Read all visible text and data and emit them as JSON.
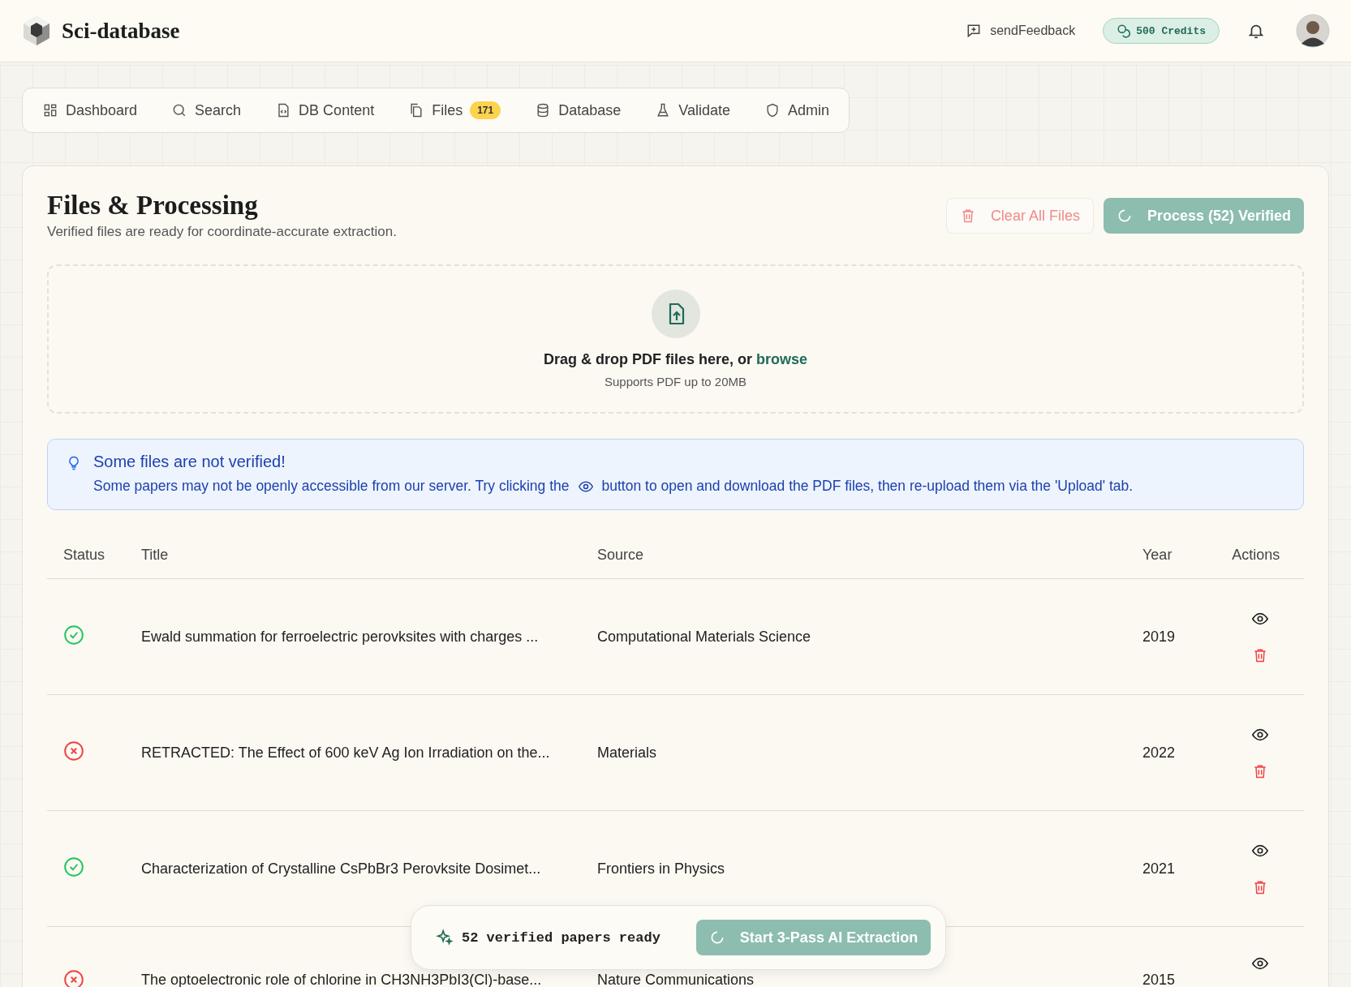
{
  "app": {
    "name": "Sci-database"
  },
  "header": {
    "feedback": "sendFeedback",
    "credits": "500 Credits"
  },
  "nav": [
    {
      "label": "Dashboard"
    },
    {
      "label": "Search"
    },
    {
      "label": "DB Content"
    },
    {
      "label": "Files",
      "badge": "171"
    },
    {
      "label": "Database"
    },
    {
      "label": "Validate"
    },
    {
      "label": "Admin"
    }
  ],
  "page": {
    "title": "Files & Processing",
    "subtitle": "Verified files are ready for coordinate-accurate extraction.",
    "clear_button": "Clear All Files",
    "process_button": "Process (52) Verified"
  },
  "dropzone": {
    "text": "Drag & drop PDF files here, or ",
    "link": "browse",
    "hint": "Supports PDF up to 20MB"
  },
  "alert": {
    "title": "Some files are not verified!",
    "text_before": "Some papers may not be openly accessible from our server. Try clicking the",
    "text_after": "button to open and download the PDF files, then re-upload them via the 'Upload' tab."
  },
  "table": {
    "columns": [
      "Status",
      "Title",
      "Source",
      "Year",
      "Actions"
    ],
    "rows": [
      {
        "verified": true,
        "title": "Ewald summation for ferroelectric perovksites with charges ...",
        "source": "Computational Materials Science",
        "year": "2019"
      },
      {
        "verified": false,
        "title": "RETRACTED: The Effect of 600 keV Ag Ion Irradiation on the...",
        "source": "Materials",
        "year": "2022"
      },
      {
        "verified": true,
        "title": "Characterization of Crystalline CsPbBr3 Perovksite Dosimet...",
        "source": "Frontiers in Physics",
        "year": "2021"
      },
      {
        "verified": false,
        "title": "The optoelectronic role of chlorine in CH3NH3PbI3(Cl)-base...",
        "source": "Nature Communications",
        "year": "2015"
      }
    ]
  },
  "floating_bar": {
    "text": "52 verified papers ready",
    "button": "Start 3-Pass AI Extraction"
  }
}
